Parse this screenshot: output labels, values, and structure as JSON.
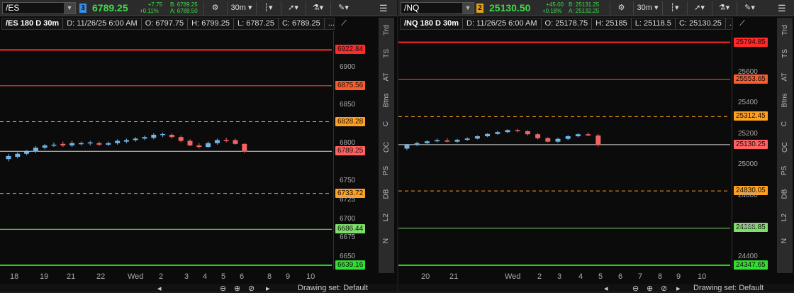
{
  "left": {
    "symbol": "/ES",
    "link_badge": "3",
    "link_color": "#3b8de0",
    "last_price": "6789.25",
    "change": "+7.75",
    "change_pct": "+0.11%",
    "bid": "B: 6789.25",
    "ask": "A: 6789.50",
    "aggregation": "30m",
    "info": {
      "title": "/ES 180 D 30m",
      "date": "D: 11/26/25 6:00 AM",
      "open": "O: 6797.75",
      "high": "H: 6799.25",
      "low": "L: 6787.25",
      "close": "C: 6789.25",
      "more": "..."
    },
    "price_axis": [
      "6900",
      "6850",
      "6800",
      "6750",
      "6725",
      "6700",
      "6675",
      "6650"
    ],
    "levels": [
      {
        "label": "6922.84",
        "price": 6922.84,
        "color": "#ff2a2a",
        "style": "solid",
        "width": 2
      },
      {
        "label": "6875.56",
        "price": 6875.56,
        "color": "#ff5a2a",
        "style": "solid",
        "width": 1
      },
      {
        "label": "6828.28",
        "price": 6828.28,
        "color": "#ffa020",
        "style": "dashed",
        "width": 1
      },
      {
        "label": "6789.25",
        "price": 6789.25,
        "color": "#ff6060",
        "style": "solid",
        "width": 1,
        "line_color": "#dddddd"
      },
      {
        "label": "6733.72",
        "price": 6733.72,
        "color": "#ffa020",
        "style": "dashed",
        "width": 1
      },
      {
        "label": "6686.44",
        "price": 6686.44,
        "color": "#7ddf6a",
        "style": "solid",
        "width": 1
      },
      {
        "label": "6639.16",
        "price": 6639.16,
        "color": "#2fe02f",
        "style": "solid",
        "width": 2
      }
    ],
    "x_labels": [
      "18",
      "19",
      "21",
      "22",
      "Wed",
      "2",
      "3",
      "4",
      "5",
      "6",
      "8",
      "9",
      "10"
    ]
  },
  "right": {
    "symbol": "/NQ",
    "link_badge": "2",
    "link_color": "#e0a020",
    "last_price": "25130.50",
    "change": "+45.00",
    "change_pct": "+0.18%",
    "bid": "B: 25131.25",
    "ask": "A: 25132.25",
    "aggregation": "30m",
    "info": {
      "title": "/NQ 180 D 30m",
      "date": "D: 11/26/25 6:00 AM",
      "open": "O: 25178.75",
      "high": "H: 25185",
      "low": "L: 25118.5",
      "close": "C: 25130.25",
      "more": "..."
    },
    "price_axis": [
      "25600",
      "25400",
      "25200",
      "25000",
      "24800",
      "24600",
      "24400"
    ],
    "levels": [
      {
        "label": "25794.85",
        "price": 25794.85,
        "color": "#ff2a2a",
        "style": "solid",
        "width": 2
      },
      {
        "label": "25553.65",
        "price": 25553.65,
        "color": "#ff5a2a",
        "style": "solid",
        "width": 1
      },
      {
        "label": "25312.45",
        "price": 25312.45,
        "color": "#ffa020",
        "style": "dashed",
        "width": 1
      },
      {
        "label": "25130.25",
        "price": 25130.25,
        "color": "#ff6060",
        "style": "solid",
        "width": 1,
        "line_color": "#dddddd"
      },
      {
        "label": "24830.05",
        "price": 24830.05,
        "color": "#ffa020",
        "style": "dashed",
        "width": 1
      },
      {
        "label": "24588.85",
        "price": 24588.85,
        "color": "#7ddf6a",
        "style": "solid",
        "width": 1
      },
      {
        "label": "24347.65",
        "price": 24347.65,
        "color": "#2fe02f",
        "style": "solid",
        "width": 2
      }
    ],
    "x_labels": [
      "20",
      "21",
      "Wed",
      "2",
      "3",
      "4",
      "5",
      "6",
      "7",
      "8",
      "9",
      "10"
    ]
  },
  "side_tabs": [
    "Trd",
    "TS",
    "AT",
    "Btns",
    "C",
    "OC",
    "PS",
    "DB",
    "L2",
    "N"
  ],
  "footer": {
    "drawing_set": "Drawing set: Default"
  },
  "toolbar_icons": [
    "gear-icon",
    "style-icon",
    "cursor-icon",
    "flask-icon",
    "drawing-icon",
    "menu-icon"
  ],
  "colors": {
    "up": "#6fb6ea",
    "down": "#f06464"
  },
  "chart_data": [
    {
      "type": "candlestick",
      "symbol": "/ES",
      "title": "/ES 180 D 30m",
      "ylim": [
        6639,
        6940
      ],
      "candles": [
        {
          "o": 6779,
          "h": 6786,
          "l": 6776,
          "c": 6783
        },
        {
          "o": 6782,
          "h": 6788,
          "l": 6780,
          "c": 6786
        },
        {
          "o": 6786,
          "h": 6791,
          "l": 6784,
          "c": 6789
        },
        {
          "o": 6789,
          "h": 6796,
          "l": 6787,
          "c": 6794
        },
        {
          "o": 6794,
          "h": 6799,
          "l": 6792,
          "c": 6797
        },
        {
          "o": 6797,
          "h": 6801,
          "l": 6795,
          "c": 6798
        },
        {
          "o": 6799,
          "h": 6802,
          "l": 6795,
          "c": 6797
        },
        {
          "o": 6797,
          "h": 6803,
          "l": 6795,
          "c": 6800
        },
        {
          "o": 6799,
          "h": 6802,
          "l": 6797,
          "c": 6800
        },
        {
          "o": 6800,
          "h": 6803,
          "l": 6797,
          "c": 6801
        },
        {
          "o": 6800,
          "h": 6802,
          "l": 6796,
          "c": 6798
        },
        {
          "o": 6798,
          "h": 6802,
          "l": 6796,
          "c": 6800
        },
        {
          "o": 6800,
          "h": 6805,
          "l": 6798,
          "c": 6803
        },
        {
          "o": 6802,
          "h": 6806,
          "l": 6800,
          "c": 6804
        },
        {
          "o": 6804,
          "h": 6808,
          "l": 6802,
          "c": 6806
        },
        {
          "o": 6806,
          "h": 6810,
          "l": 6804,
          "c": 6808
        },
        {
          "o": 6807,
          "h": 6813,
          "l": 6805,
          "c": 6811
        },
        {
          "o": 6811,
          "h": 6814,
          "l": 6808,
          "c": 6812
        },
        {
          "o": 6811,
          "h": 6813,
          "l": 6806,
          "c": 6808
        },
        {
          "o": 6808,
          "h": 6810,
          "l": 6801,
          "c": 6803
        },
        {
          "o": 6803,
          "h": 6805,
          "l": 6796,
          "c": 6797
        },
        {
          "o": 6797,
          "h": 6800,
          "l": 6793,
          "c": 6795
        },
        {
          "o": 6795,
          "h": 6802,
          "l": 6794,
          "c": 6800
        },
        {
          "o": 6800,
          "h": 6806,
          "l": 6798,
          "c": 6804
        },
        {
          "o": 6804,
          "h": 6807,
          "l": 6801,
          "c": 6803
        },
        {
          "o": 6804,
          "h": 6806,
          "l": 6798,
          "c": 6799
        },
        {
          "o": 6799,
          "h": 6800,
          "l": 6787,
          "c": 6789
        }
      ]
    },
    {
      "type": "candlestick",
      "symbol": "/NQ",
      "title": "/NQ 180 D 30m",
      "ylim": [
        24347,
        25830
      ],
      "candles": [
        {
          "o": 25105,
          "h": 25135,
          "l": 25095,
          "c": 25128
        },
        {
          "o": 25128,
          "h": 25150,
          "l": 25120,
          "c": 25140
        },
        {
          "o": 25140,
          "h": 25160,
          "l": 25130,
          "c": 25152
        },
        {
          "o": 25152,
          "h": 25170,
          "l": 25145,
          "c": 25160
        },
        {
          "o": 25158,
          "h": 25172,
          "l": 25145,
          "c": 25150
        },
        {
          "o": 25150,
          "h": 25168,
          "l": 25142,
          "c": 25162
        },
        {
          "o": 25162,
          "h": 25178,
          "l": 25155,
          "c": 25170
        },
        {
          "o": 25170,
          "h": 25190,
          "l": 25165,
          "c": 25185
        },
        {
          "o": 25185,
          "h": 25205,
          "l": 25180,
          "c": 25200
        },
        {
          "o": 25200,
          "h": 25220,
          "l": 25195,
          "c": 25212
        },
        {
          "o": 25212,
          "h": 25230,
          "l": 25205,
          "c": 25225
        },
        {
          "o": 25225,
          "h": 25232,
          "l": 25210,
          "c": 25218
        },
        {
          "o": 25218,
          "h": 25225,
          "l": 25190,
          "c": 25198
        },
        {
          "o": 25198,
          "h": 25205,
          "l": 25165,
          "c": 25172
        },
        {
          "o": 25172,
          "h": 25180,
          "l": 25145,
          "c": 25150
        },
        {
          "o": 25150,
          "h": 25175,
          "l": 25142,
          "c": 25168
        },
        {
          "o": 25168,
          "h": 25192,
          "l": 25160,
          "c": 25185
        },
        {
          "o": 25185,
          "h": 25205,
          "l": 25178,
          "c": 25198
        },
        {
          "o": 25198,
          "h": 25210,
          "l": 25185,
          "c": 25190
        },
        {
          "o": 25190,
          "h": 25200,
          "l": 25118,
          "c": 25130
        }
      ]
    }
  ]
}
